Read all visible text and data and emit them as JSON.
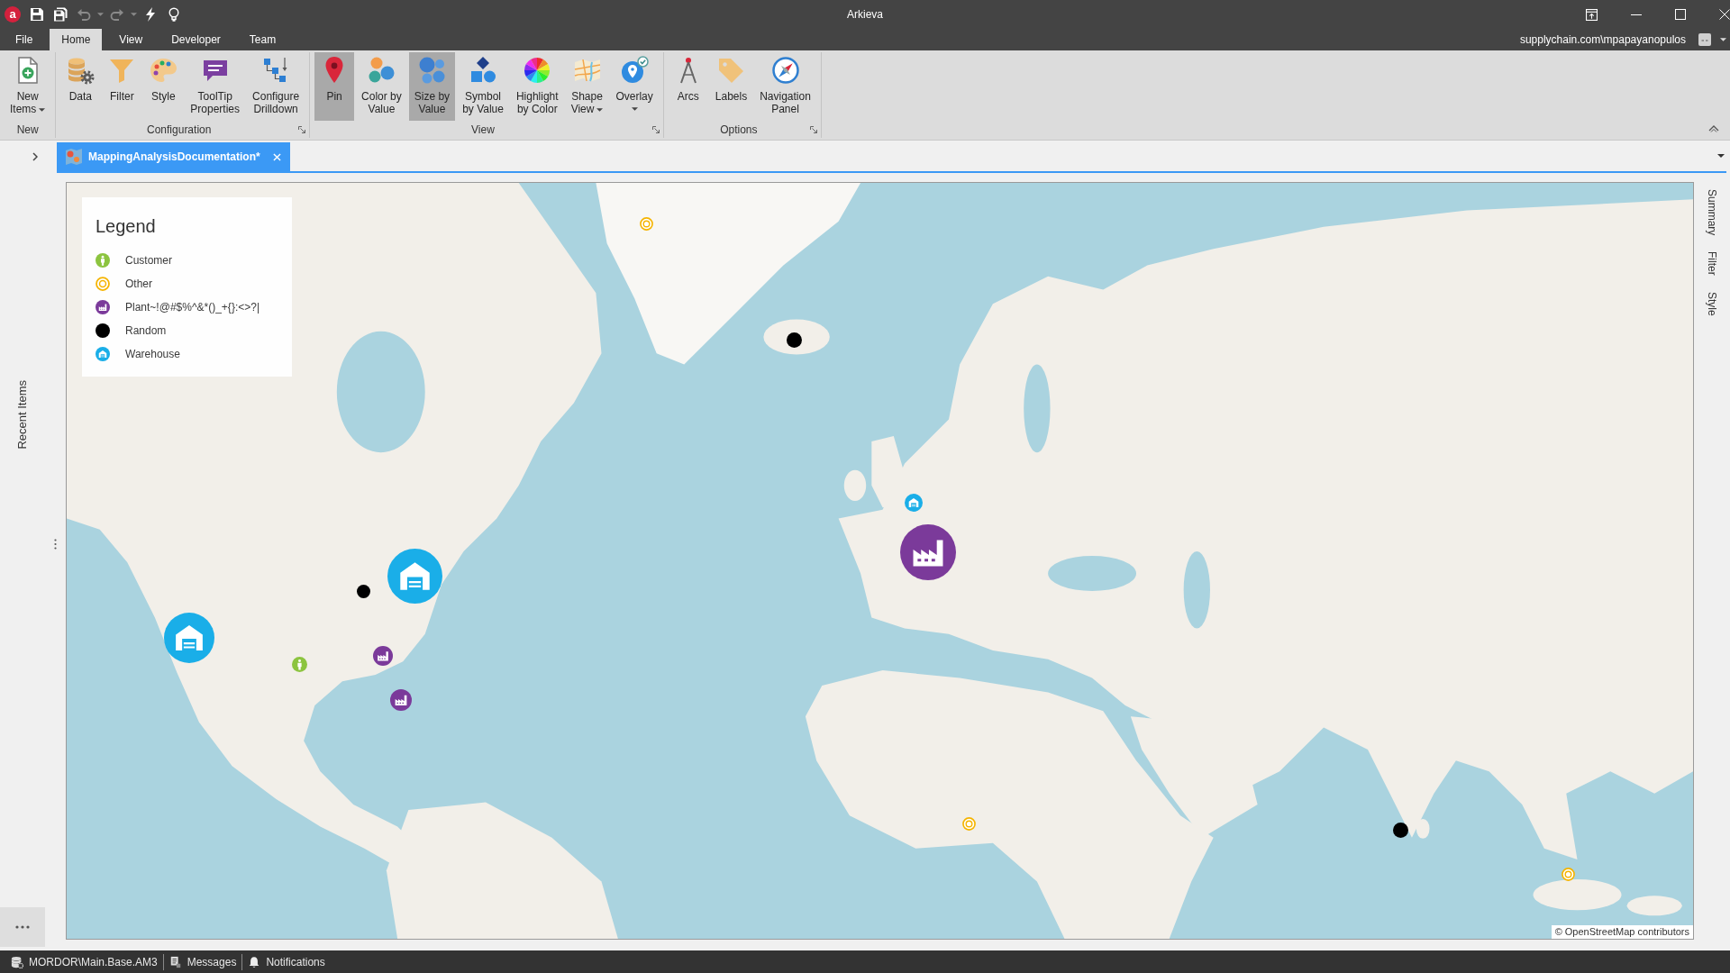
{
  "title_bar": {
    "logo": "a",
    "title": "Arkieva"
  },
  "menu": {
    "tabs": [
      {
        "label": "File",
        "selected": false
      },
      {
        "label": "Home",
        "selected": true
      },
      {
        "label": "View",
        "selected": false
      },
      {
        "label": "Developer",
        "selected": false
      },
      {
        "label": "Team",
        "selected": false
      }
    ],
    "account": "supplychain.com\\mpapayanopulos"
  },
  "ribbon": {
    "groups": [
      {
        "label": "New",
        "launcher": false,
        "buttons": [
          {
            "label": "New\nItems",
            "dropdown": true,
            "selected": false
          }
        ]
      },
      {
        "label": "Configuration",
        "launcher": true,
        "buttons": [
          {
            "label": "Data",
            "dropdown": false,
            "selected": false
          },
          {
            "label": "Filter",
            "dropdown": false,
            "selected": false
          },
          {
            "label": "Style",
            "dropdown": false,
            "selected": false
          },
          {
            "label": "ToolTip\nProperties",
            "dropdown": false,
            "selected": false
          },
          {
            "label": "Configure\nDrilldown",
            "dropdown": false,
            "selected": false
          }
        ]
      },
      {
        "label": "View",
        "launcher": true,
        "buttons": [
          {
            "label": "Pin",
            "dropdown": false,
            "selected": true
          },
          {
            "label": "Color by\nValue",
            "dropdown": false,
            "selected": false
          },
          {
            "label": "Size by\nValue",
            "dropdown": false,
            "selected": true
          },
          {
            "label": "Symbol\nby Value",
            "dropdown": false,
            "selected": false
          },
          {
            "label": "Highlight\nby Color",
            "dropdown": false,
            "selected": false
          },
          {
            "label": "Shape\nView",
            "dropdown": true,
            "selected": false
          },
          {
            "label": "Overlay",
            "dropdown": true,
            "selected": false
          }
        ]
      },
      {
        "label": "Options",
        "launcher": true,
        "buttons": [
          {
            "label": "Arcs",
            "dropdown": false,
            "selected": false
          },
          {
            "label": "Labels",
            "dropdown": false,
            "selected": false
          },
          {
            "label": "Navigation\nPanel",
            "dropdown": false,
            "selected": false
          }
        ]
      }
    ]
  },
  "document_tab": {
    "title": "MappingAnalysisDocumentation*"
  },
  "side_panel": {
    "label": "Recent Items"
  },
  "right_panel": {
    "tabs": [
      {
        "label": "Summary"
      },
      {
        "label": "Filter"
      },
      {
        "label": "Style"
      }
    ]
  },
  "map": {
    "legend": {
      "title": "Legend",
      "items": [
        {
          "kind": "customer",
          "label": "Customer"
        },
        {
          "kind": "other",
          "label": "Other"
        },
        {
          "kind": "plant",
          "label": "Plant~!@#$%^&*()_+{}:<>?|"
        },
        {
          "kind": "random",
          "label": "Random"
        },
        {
          "kind": "warehouse",
          "label": "Warehouse"
        }
      ]
    },
    "markers": [
      {
        "kind": "other"
      },
      {
        "kind": "random"
      },
      {
        "kind": "warehouse"
      },
      {
        "kind": "plant"
      },
      {
        "kind": "warehouse"
      },
      {
        "kind": "random"
      },
      {
        "kind": "warehouse"
      },
      {
        "kind": "customer"
      },
      {
        "kind": "plant"
      },
      {
        "kind": "plant"
      },
      {
        "kind": "other"
      },
      {
        "kind": "random"
      },
      {
        "kind": "other"
      }
    ],
    "attribution": "© OpenStreetMap contributors"
  },
  "status_bar": {
    "items": [
      {
        "label": "MORDOR\\Main.Base.AM3"
      },
      {
        "label": "Messages"
      },
      {
        "label": "Notifications"
      }
    ]
  }
}
